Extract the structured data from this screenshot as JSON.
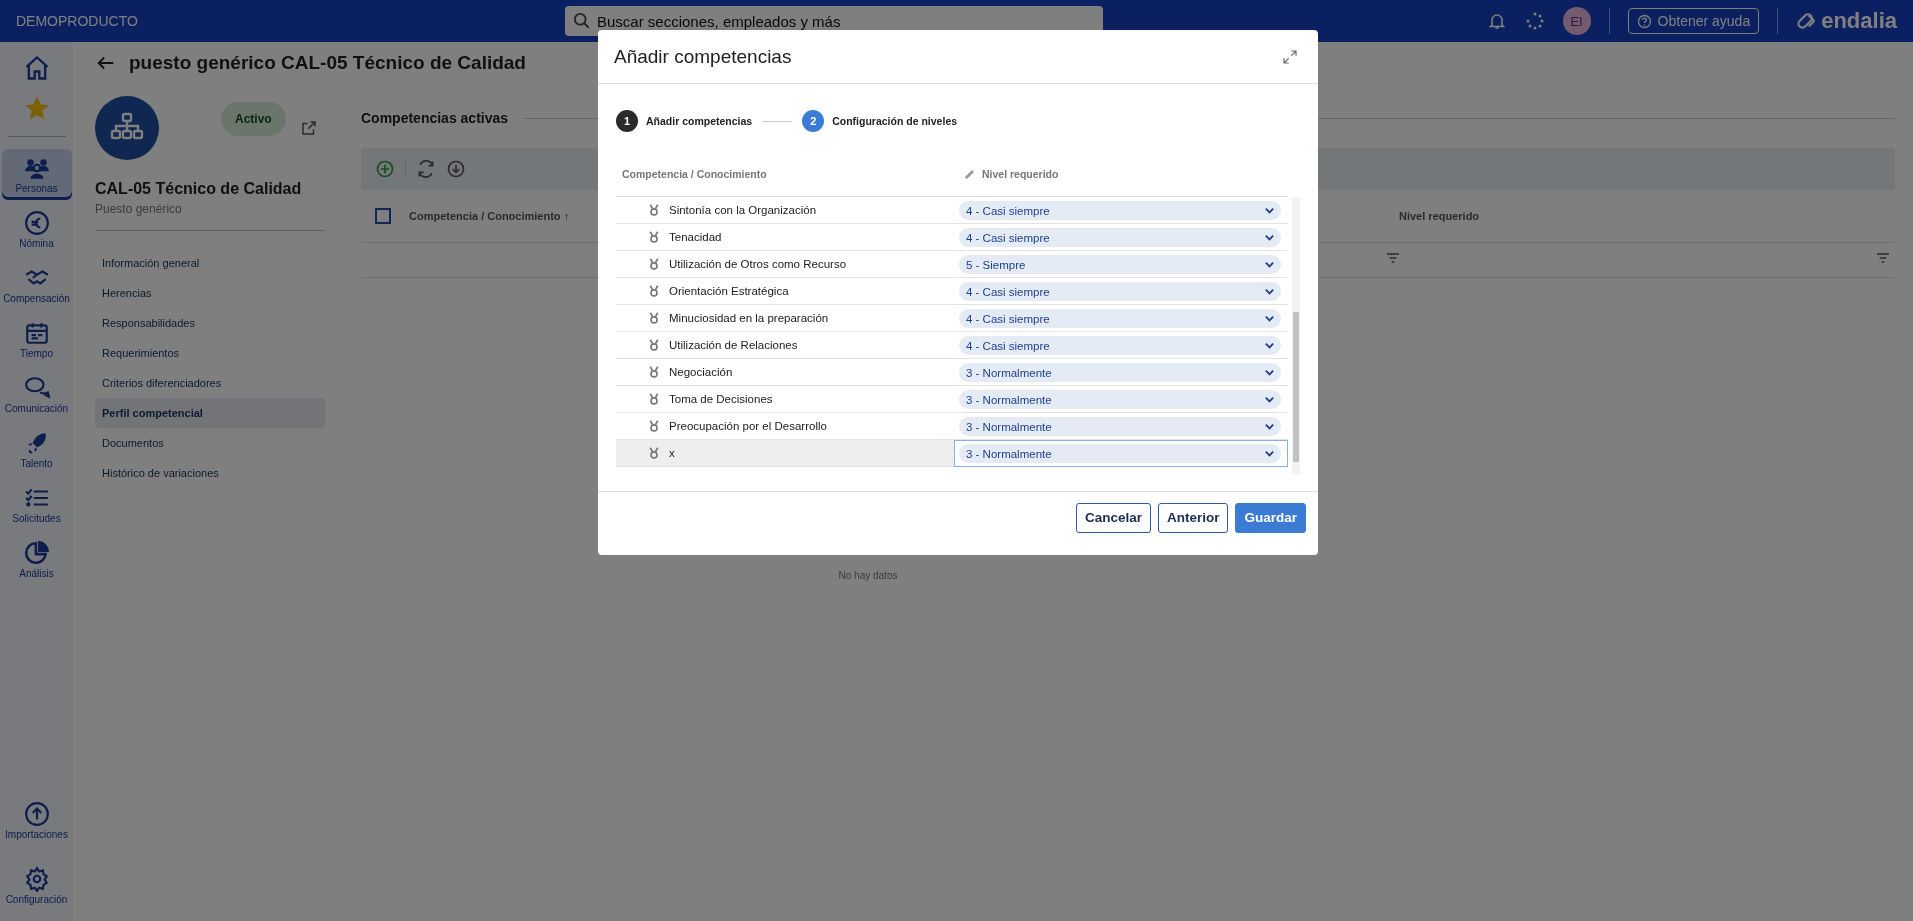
{
  "topbar": {
    "brand": "DEMOPRODUCTO",
    "search": {
      "placeholder": "Buscar secciones, empleados y más"
    },
    "avatar": "EI",
    "help": "Obtener ayuda",
    "logo": "endalia"
  },
  "rail": {
    "items": [
      {
        "label": "Personas",
        "selected": true
      },
      {
        "label": "Nómina",
        "selected": false
      },
      {
        "label": "Compensación",
        "selected": false
      },
      {
        "label": "Tiempo",
        "selected": false
      },
      {
        "label": "Comunicación",
        "selected": false
      },
      {
        "label": "Talento",
        "selected": false
      },
      {
        "label": "Solicitudes",
        "selected": false
      },
      {
        "label": "Análisis",
        "selected": false
      }
    ],
    "bottom": [
      {
        "label": "Importaciones"
      },
      {
        "label": "Configuración"
      }
    ]
  },
  "page": {
    "title": "puesto genérico CAL-05 Técnico de Calidad",
    "status": "Activo",
    "name": "CAL-05 Técnico de Calidad",
    "subtitle": "Puesto genérico",
    "nav": [
      {
        "label": "Información general",
        "selected": false
      },
      {
        "label": "Herencias",
        "selected": false
      },
      {
        "label": "Responsabilidades",
        "selected": false
      },
      {
        "label": "Requerimientos",
        "selected": false
      },
      {
        "label": "Criterios diferenciadores",
        "selected": false
      },
      {
        "label": "Perfil competencial",
        "selected": true
      },
      {
        "label": "Documentos",
        "selected": false
      },
      {
        "label": "Histórico de variaciones",
        "selected": false
      }
    ]
  },
  "main": {
    "section": "Competencias activas",
    "select_all": {
      "checked": false
    },
    "columns": [
      "Competencia / Conocimiento",
      "Nivel requerido"
    ],
    "sort_mark": "↑",
    "empty": "No hay datos"
  },
  "modal": {
    "title": "Añadir competencias",
    "steps": [
      {
        "number": "1",
        "label": "Añadir competencias",
        "selected": false
      },
      {
        "number": "2",
        "label": "Configuración de niveles",
        "selected": true
      }
    ],
    "columns": [
      "Competencia / Conocimiento",
      "Nivel requerido"
    ],
    "rows": [
      {
        "name": "Sintonía con la Organización",
        "level": "4 - Casi siempre",
        "selected": false
      },
      {
        "name": "Tenacidad",
        "level": "4 - Casi siempre",
        "selected": false
      },
      {
        "name": "Utilización de Otros como Recurso",
        "level": "5 - Siempre",
        "selected": false
      },
      {
        "name": "Orientación Estratégica",
        "level": "4 - Casi siempre",
        "selected": false
      },
      {
        "name": "Minuciosidad en la preparación",
        "level": "4 - Casi siempre",
        "selected": false
      },
      {
        "name": "Utilización de Relaciones",
        "level": "4 - Casi siempre",
        "selected": false
      },
      {
        "name": "Negociación",
        "level": "3 - Normalmente",
        "selected": false
      },
      {
        "name": "Toma de Decisiones",
        "level": "3 - Normalmente",
        "selected": false
      },
      {
        "name": "Preocupación por el Desarrollo",
        "level": "3 - Normalmente",
        "selected": false
      },
      {
        "name": "x",
        "level": "3 - Normalmente",
        "selected": true
      }
    ],
    "buttons": [
      {
        "label": "Cancelar",
        "kind": "secondary"
      },
      {
        "label": "Anterior",
        "kind": "secondary"
      },
      {
        "label": "Guardar",
        "kind": "primary"
      }
    ]
  }
}
